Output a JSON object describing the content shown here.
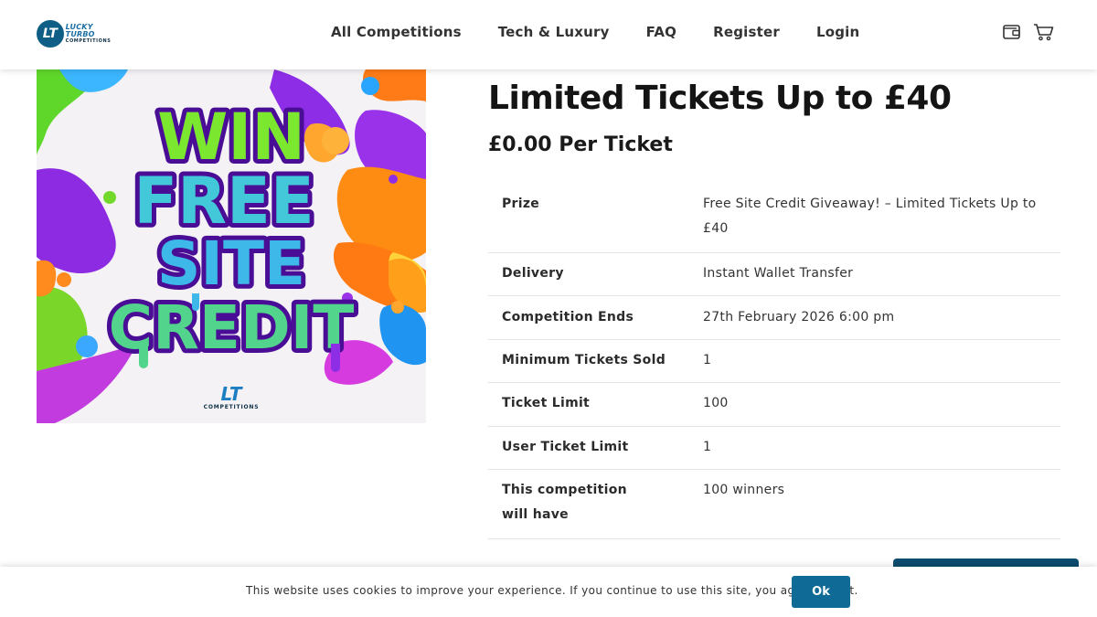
{
  "logo": {
    "badge": "LT",
    "line1": "LUCKY TURBO",
    "line2": "COMPETITIONS"
  },
  "nav": {
    "items": [
      "All Competitions",
      "Tech & Luxury",
      "FAQ",
      "Register",
      "Login"
    ]
  },
  "header_icons": [
    "wallet-icon",
    "cart-icon"
  ],
  "image": {
    "line1": "WIN",
    "line2": "FREE",
    "line3": "SITE",
    "line4": "CREDIT",
    "brand_badge": "LT",
    "brand_sub": "COMPETITIONS"
  },
  "product": {
    "title": "Limited Tickets Up to £40",
    "price": "£0.00 Per Ticket"
  },
  "specs": [
    {
      "label": "Prize",
      "value": "Free Site Credit Giveaway! – Limited Tickets Up to £40"
    },
    {
      "label": "Delivery",
      "value": "Instant Wallet Transfer"
    },
    {
      "label": "Competition Ends",
      "value": "27th February 2026 6:00 pm"
    },
    {
      "label": "Minimum Tickets Sold",
      "value": "1"
    },
    {
      "label": "Ticket Limit",
      "value": "100"
    },
    {
      "label": "User Ticket Limit",
      "value": "1"
    },
    {
      "label": "This competition will have",
      "value": "100 winners"
    }
  ],
  "cookie": {
    "text": "This website uses cookies to improve your experience. If you continue to use this site, you agree with it.",
    "ok_label": "Ok"
  },
  "colors": {
    "accent": "#0f6a95",
    "dark_accent": "#0c4c6e"
  }
}
